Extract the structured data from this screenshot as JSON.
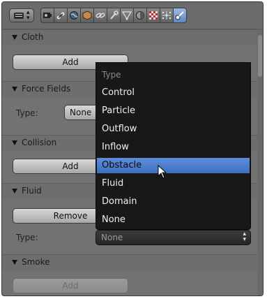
{
  "header": {
    "tabs": [
      {
        "icon": "render-icon"
      },
      {
        "icon": "scene-icon"
      },
      {
        "icon": "world-icon"
      },
      {
        "icon": "object-icon"
      },
      {
        "icon": "constraints-icon"
      },
      {
        "icon": "modifiers-icon"
      },
      {
        "icon": "data-icon"
      },
      {
        "icon": "material-icon"
      },
      {
        "icon": "texture-icon"
      },
      {
        "icon": "particles-icon"
      },
      {
        "icon": "physics-icon",
        "active": true
      }
    ]
  },
  "panels": {
    "cloth": {
      "title": "Cloth",
      "button": "Add"
    },
    "force_fields": {
      "title": "Force Fields",
      "type_label": "Type:",
      "type_value": "None"
    },
    "collision": {
      "title": "Collision",
      "button": "Add"
    },
    "fluid": {
      "title": "Fluid",
      "button": "Remove",
      "type_label": "Type:",
      "type_value": "None"
    },
    "smoke": {
      "title": "Smoke",
      "button": "Add"
    }
  },
  "menu": {
    "heading": "Type",
    "items": [
      "Control",
      "Particle",
      "Outflow",
      "Inflow",
      "Obstacle",
      "Fluid",
      "Domain",
      "None"
    ],
    "selected": "Obstacle"
  },
  "colors": {
    "accent": "#5680c8",
    "menu_bg": "#181818",
    "panel_bg": "#727272"
  }
}
